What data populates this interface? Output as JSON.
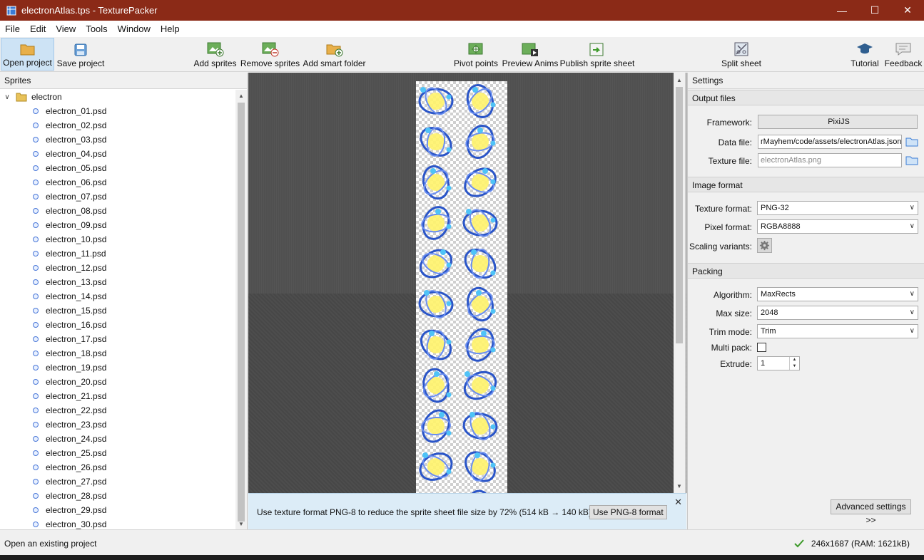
{
  "window": {
    "title": "electronAtlas.tps - TexturePacker",
    "minimize": "—",
    "maximize": "☐",
    "close": "✕"
  },
  "menu": [
    "File",
    "Edit",
    "View",
    "Tools",
    "Window",
    "Help"
  ],
  "toolbar": {
    "open_project": "Open project",
    "save_project": "Save project",
    "add_sprites": "Add sprites",
    "remove_sprites": "Remove sprites",
    "add_smart_folder": "Add smart folder",
    "pivot_points": "Pivot points",
    "preview_anims": "Preview Anims",
    "publish_sprite_sheet": "Publish sprite sheet",
    "split_sheet": "Split sheet",
    "tutorial": "Tutorial",
    "feedback": "Feedback"
  },
  "sprites_panel": {
    "title": "Sprites",
    "folder": "electron",
    "items": [
      "electron_01.psd",
      "electron_02.psd",
      "electron_03.psd",
      "electron_04.psd",
      "electron_05.psd",
      "electron_06.psd",
      "electron_07.psd",
      "electron_08.psd",
      "electron_09.psd",
      "electron_10.psd",
      "electron_11.psd",
      "electron_12.psd",
      "electron_13.psd",
      "electron_14.psd",
      "electron_15.psd",
      "electron_16.psd",
      "electron_17.psd",
      "electron_18.psd",
      "electron_19.psd",
      "electron_20.psd",
      "electron_21.psd",
      "electron_22.psd",
      "electron_23.psd",
      "electron_24.psd",
      "electron_25.psd",
      "electron_26.psd",
      "electron_27.psd",
      "electron_28.psd",
      "electron_29.psd",
      "electron_30.psd"
    ]
  },
  "notification": {
    "message": "Use texture format PNG-8 to reduce the sprite sheet file size by 72% (514 kB → 140 kB)!",
    "button": "Use PNG-8 format",
    "close": "✕"
  },
  "settings": {
    "title": "Settings",
    "output_files": {
      "header": "Output files",
      "framework_label": "Framework:",
      "framework_value": "PixiJS",
      "data_file_label": "Data file:",
      "data_file_value": "rMayhem/code/assets/electronAtlas.json",
      "texture_file_label": "Texture file:",
      "texture_file_placeholder": "electronAtlas.png"
    },
    "image_format": {
      "header": "Image format",
      "texture_format_label": "Texture format:",
      "texture_format_value": "PNG-32",
      "pixel_format_label": "Pixel format:",
      "pixel_format_value": "RGBA8888",
      "scaling_variants_label": "Scaling variants:"
    },
    "packing": {
      "header": "Packing",
      "algorithm_label": "Algorithm:",
      "algorithm_value": "MaxRects",
      "max_size_label": "Max size:",
      "max_size_value": "2048",
      "trim_mode_label": "Trim mode:",
      "trim_mode_value": "Trim",
      "multi_pack_label": "Multi pack:",
      "multi_pack_checked": false,
      "extrude_label": "Extrude:",
      "extrude_value": "1"
    },
    "advanced_button": "Advanced settings >>"
  },
  "statusbar": {
    "message": "Open an existing project",
    "info": "246x1687 (RAM: 1621kB)"
  },
  "colors": {
    "titlebar": "#8b2a17",
    "accent": "#cde3f5",
    "notification": "#dcecf7"
  }
}
